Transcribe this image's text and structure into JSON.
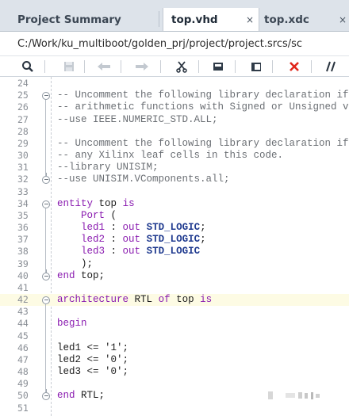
{
  "tabs": [
    {
      "label": "Project Summary",
      "active": false
    },
    {
      "label": "top.vhd",
      "active": true
    },
    {
      "label": "top.xdc",
      "active": false
    }
  ],
  "tab_close_glyph": "×",
  "path": "C:/Work/ku_multiboot/golden_prj/project/project.srcs/sc",
  "toolbar": [
    {
      "name": "search-icon",
      "enabled": true
    },
    {
      "name": "save-icon",
      "enabled": false
    },
    {
      "name": "undo-icon",
      "enabled": false
    },
    {
      "name": "redo-icon",
      "enabled": false
    },
    {
      "name": "cut-icon",
      "enabled": true
    },
    {
      "name": "copy-icon",
      "enabled": true
    },
    {
      "name": "paste-icon",
      "enabled": true
    },
    {
      "name": "delete-icon",
      "enabled": true
    },
    {
      "name": "comment-icon",
      "enabled": true
    }
  ],
  "colors": {
    "keyword": "#8a1bb0",
    "comment": "#6b6f74",
    "type": "#1f3a8f",
    "highlight_line": "#fdfbe4",
    "delete_red": "#e0261b"
  },
  "highlighted_line": 42,
  "lines": [
    {
      "n": "24",
      "fold": "",
      "tokens": []
    },
    {
      "n": "25",
      "fold": "start",
      "tokens": [
        {
          "t": "c",
          "v": "-- Uncomment the following library declaration if using"
        }
      ]
    },
    {
      "n": "26",
      "fold": "",
      "tokens": [
        {
          "t": "c",
          "v": "-- arithmetic functions with Signed or Unsigned values"
        }
      ]
    },
    {
      "n": "27",
      "fold": "",
      "tokens": [
        {
          "t": "c",
          "v": "--use IEEE.NUMERIC_STD.ALL;"
        }
      ]
    },
    {
      "n": "28",
      "fold": "",
      "tokens": []
    },
    {
      "n": "29",
      "fold": "",
      "tokens": [
        {
          "t": "c",
          "v": "-- Uncomment the following library declaration if instantiating"
        }
      ]
    },
    {
      "n": "30",
      "fold": "",
      "tokens": [
        {
          "t": "c",
          "v": "-- any Xilinx leaf cells in this code."
        }
      ]
    },
    {
      "n": "31",
      "fold": "",
      "tokens": [
        {
          "t": "c",
          "v": "--library UNISIM;"
        }
      ]
    },
    {
      "n": "32",
      "fold": "end",
      "tokens": [
        {
          "t": "c",
          "v": "--use UNISIM.VComponents.all;"
        }
      ]
    },
    {
      "n": "33",
      "fold": "",
      "tokens": []
    },
    {
      "n": "34",
      "fold": "start",
      "tokens": [
        {
          "t": "k",
          "v": "entity"
        },
        {
          "t": "p",
          "v": " "
        },
        {
          "t": "id",
          "v": "top"
        },
        {
          "t": "p",
          "v": " "
        },
        {
          "t": "k",
          "v": "is"
        }
      ]
    },
    {
      "n": "35",
      "fold": "",
      "tokens": [
        {
          "t": "p",
          "v": "    "
        },
        {
          "t": "k",
          "v": "Port"
        },
        {
          "t": "p",
          "v": " ("
        }
      ]
    },
    {
      "n": "36",
      "fold": "",
      "tokens": [
        {
          "t": "p",
          "v": "    "
        },
        {
          "t": "k",
          "v": "led1"
        },
        {
          "t": "p",
          "v": " : "
        },
        {
          "t": "k",
          "v": "out"
        },
        {
          "t": "p",
          "v": " "
        },
        {
          "t": "ty",
          "v": "STD_LOGIC"
        },
        {
          "t": "p",
          "v": ";"
        }
      ]
    },
    {
      "n": "37",
      "fold": "",
      "tokens": [
        {
          "t": "p",
          "v": "    "
        },
        {
          "t": "k",
          "v": "led2"
        },
        {
          "t": "p",
          "v": " : "
        },
        {
          "t": "k",
          "v": "out"
        },
        {
          "t": "p",
          "v": " "
        },
        {
          "t": "ty",
          "v": "STD_LOGIC"
        },
        {
          "t": "p",
          "v": ";"
        }
      ]
    },
    {
      "n": "38",
      "fold": "",
      "tokens": [
        {
          "t": "p",
          "v": "    "
        },
        {
          "t": "k",
          "v": "led3"
        },
        {
          "t": "p",
          "v": " : "
        },
        {
          "t": "k",
          "v": "out"
        },
        {
          "t": "p",
          "v": " "
        },
        {
          "t": "ty",
          "v": "STD_LOGIC"
        }
      ]
    },
    {
      "n": "39",
      "fold": "",
      "tokens": [
        {
          "t": "p",
          "v": "    );"
        }
      ]
    },
    {
      "n": "40",
      "fold": "end",
      "tokens": [
        {
          "t": "k",
          "v": "end"
        },
        {
          "t": "p",
          "v": " "
        },
        {
          "t": "id",
          "v": "top"
        },
        {
          "t": "p",
          "v": ";"
        }
      ]
    },
    {
      "n": "41",
      "fold": "",
      "tokens": []
    },
    {
      "n": "42",
      "fold": "start",
      "tokens": [
        {
          "t": "k",
          "v": "architecture"
        },
        {
          "t": "p",
          "v": " "
        },
        {
          "t": "id",
          "v": "RTL"
        },
        {
          "t": "p",
          "v": " "
        },
        {
          "t": "k",
          "v": "of"
        },
        {
          "t": "p",
          "v": " "
        },
        {
          "t": "id",
          "v": "top"
        },
        {
          "t": "p",
          "v": " "
        },
        {
          "t": "k",
          "v": "is"
        }
      ]
    },
    {
      "n": "43",
      "fold": "",
      "tokens": []
    },
    {
      "n": "44",
      "fold": "",
      "tokens": [
        {
          "t": "k",
          "v": "begin"
        }
      ]
    },
    {
      "n": "45",
      "fold": "",
      "tokens": []
    },
    {
      "n": "46",
      "fold": "",
      "tokens": [
        {
          "t": "id",
          "v": "led1"
        },
        {
          "t": "p",
          "v": " <= "
        },
        {
          "t": "s",
          "v": "'1'"
        },
        {
          "t": "p",
          "v": ";"
        }
      ]
    },
    {
      "n": "47",
      "fold": "",
      "tokens": [
        {
          "t": "id",
          "v": "led2"
        },
        {
          "t": "p",
          "v": " <= "
        },
        {
          "t": "s",
          "v": "'0'"
        },
        {
          "t": "p",
          "v": ";"
        }
      ]
    },
    {
      "n": "48",
      "fold": "",
      "tokens": [
        {
          "t": "id",
          "v": "led3"
        },
        {
          "t": "p",
          "v": " <= "
        },
        {
          "t": "s",
          "v": "'0'"
        },
        {
          "t": "p",
          "v": ";"
        }
      ]
    },
    {
      "n": "49",
      "fold": "",
      "tokens": []
    },
    {
      "n": "50",
      "fold": "end",
      "tokens": [
        {
          "t": "k",
          "v": "end"
        },
        {
          "t": "p",
          "v": " "
        },
        {
          "t": "id",
          "v": "RTL"
        },
        {
          "t": "p",
          "v": ";"
        }
      ]
    },
    {
      "n": "51",
      "fold": "",
      "tokens": []
    }
  ]
}
